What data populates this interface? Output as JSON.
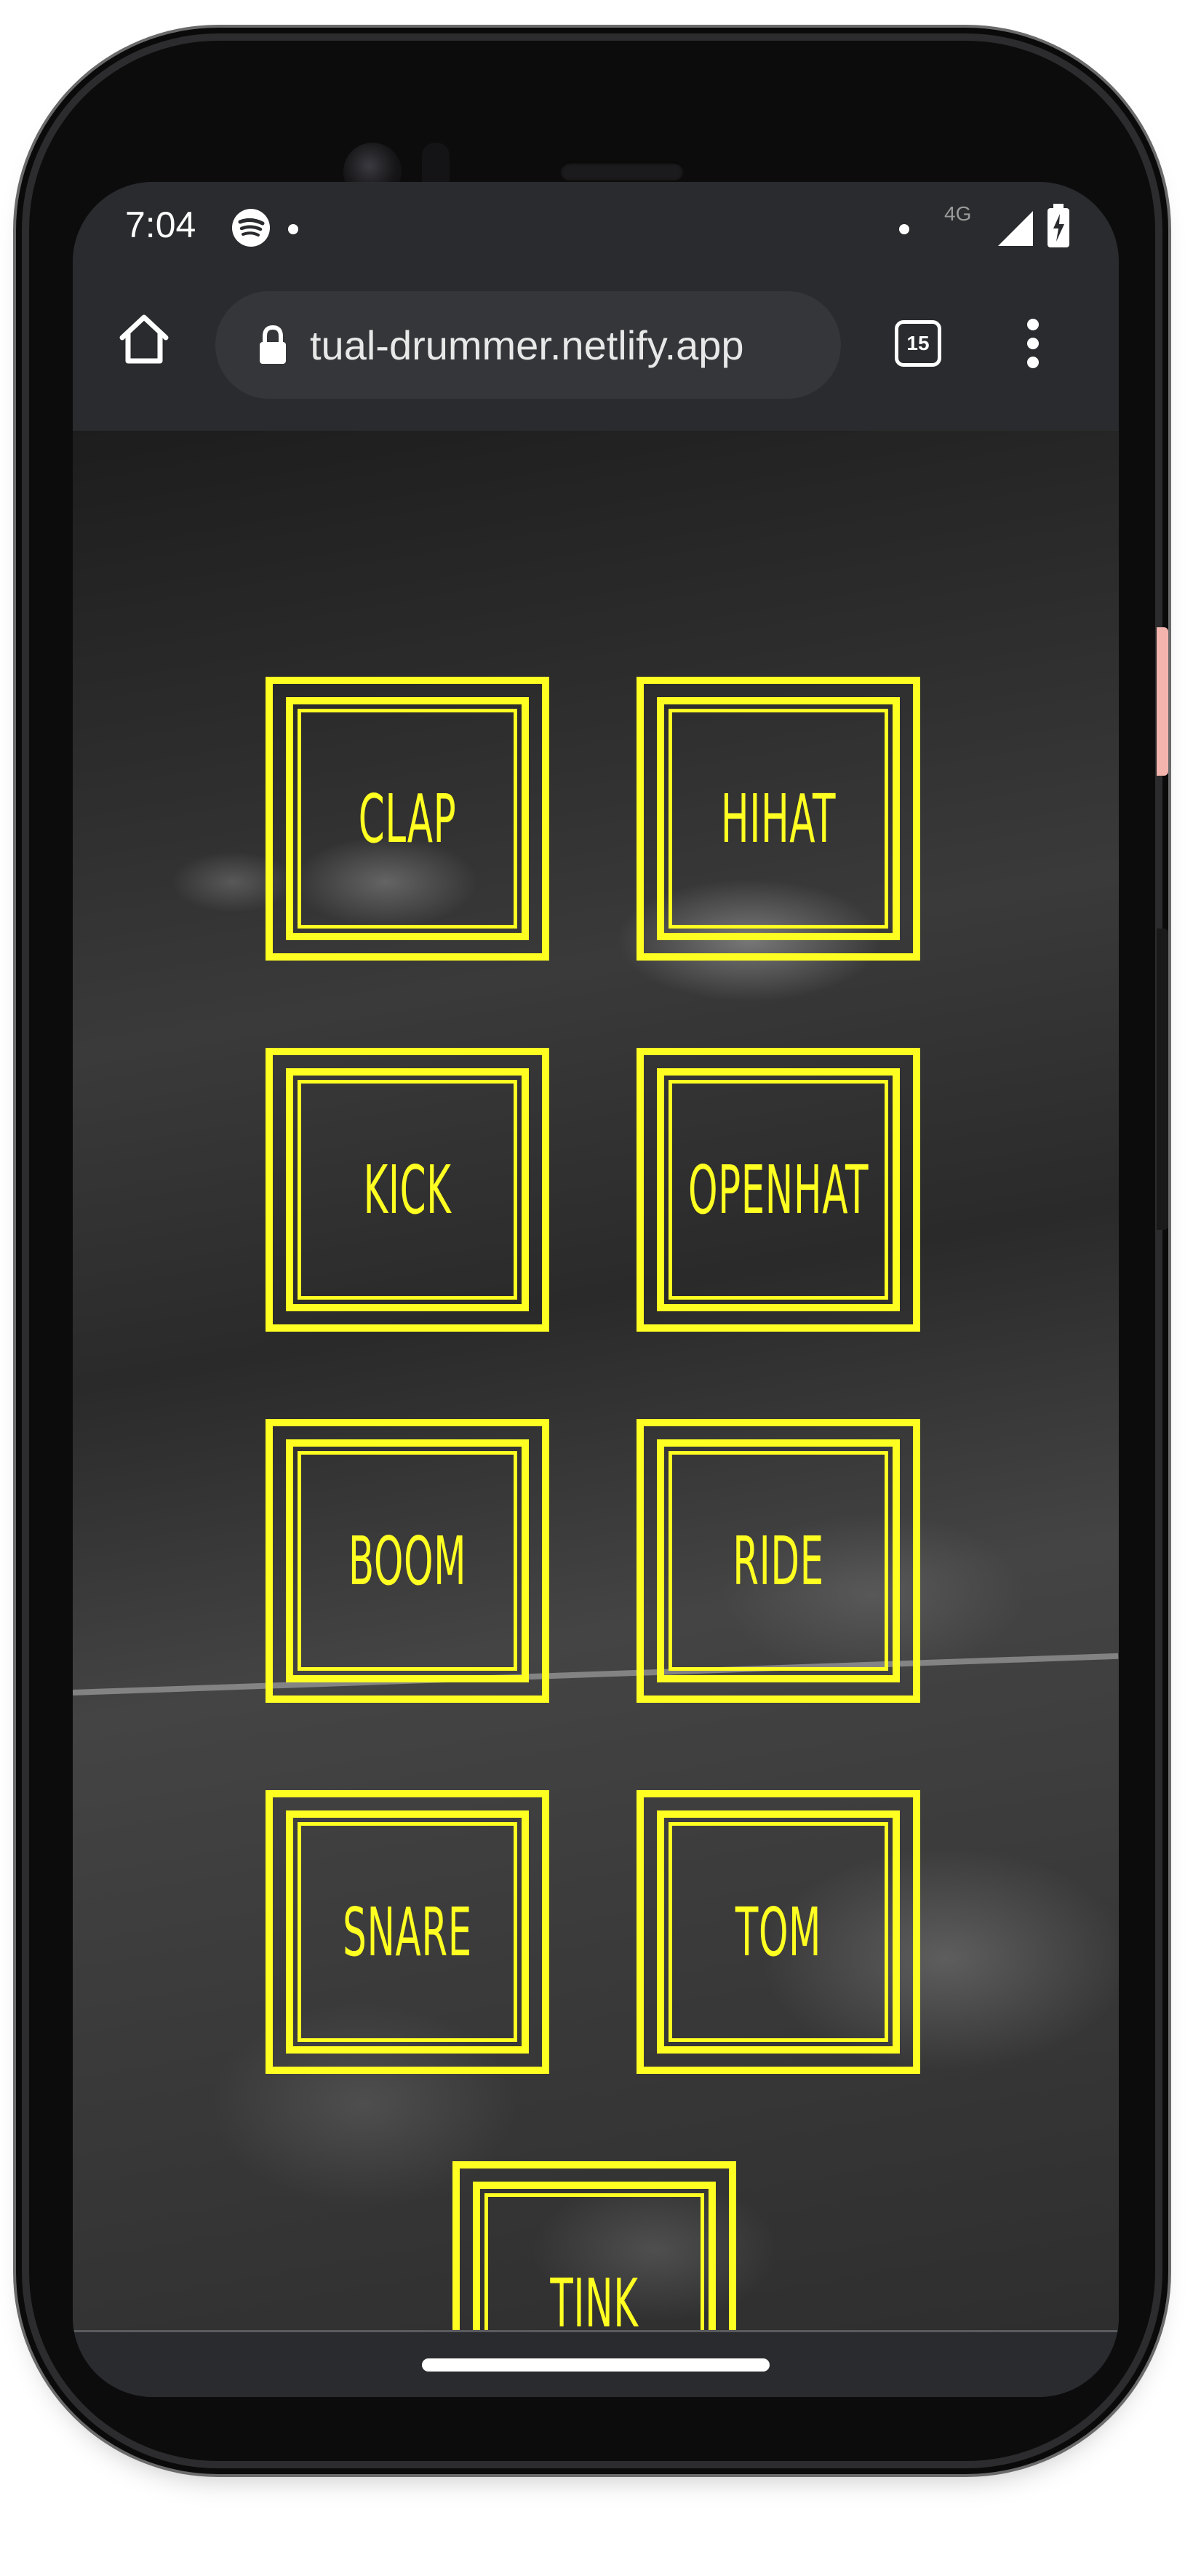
{
  "status_bar": {
    "time": "7:04",
    "network_label": "4G",
    "icons": [
      "spotify-icon",
      "signal-icon",
      "battery-charging-icon"
    ]
  },
  "browser": {
    "url": "tual-drummer.netlify.app",
    "tab_count": "15",
    "icons": [
      "home-icon",
      "lock-icon",
      "menu-icon"
    ]
  },
  "pads": [
    {
      "label": "CLAP"
    },
    {
      "label": "HIHAT"
    },
    {
      "label": "KICK"
    },
    {
      "label": "OPENHAT"
    },
    {
      "label": "BOOM"
    },
    {
      "label": "RIDE"
    },
    {
      "label": "SNARE"
    },
    {
      "label": "TOM"
    },
    {
      "label": "TINK"
    }
  ],
  "theme": {
    "accent": "#ffff22",
    "browser_bg": "#2a2b2e",
    "omnibox_bg": "#35363a"
  }
}
